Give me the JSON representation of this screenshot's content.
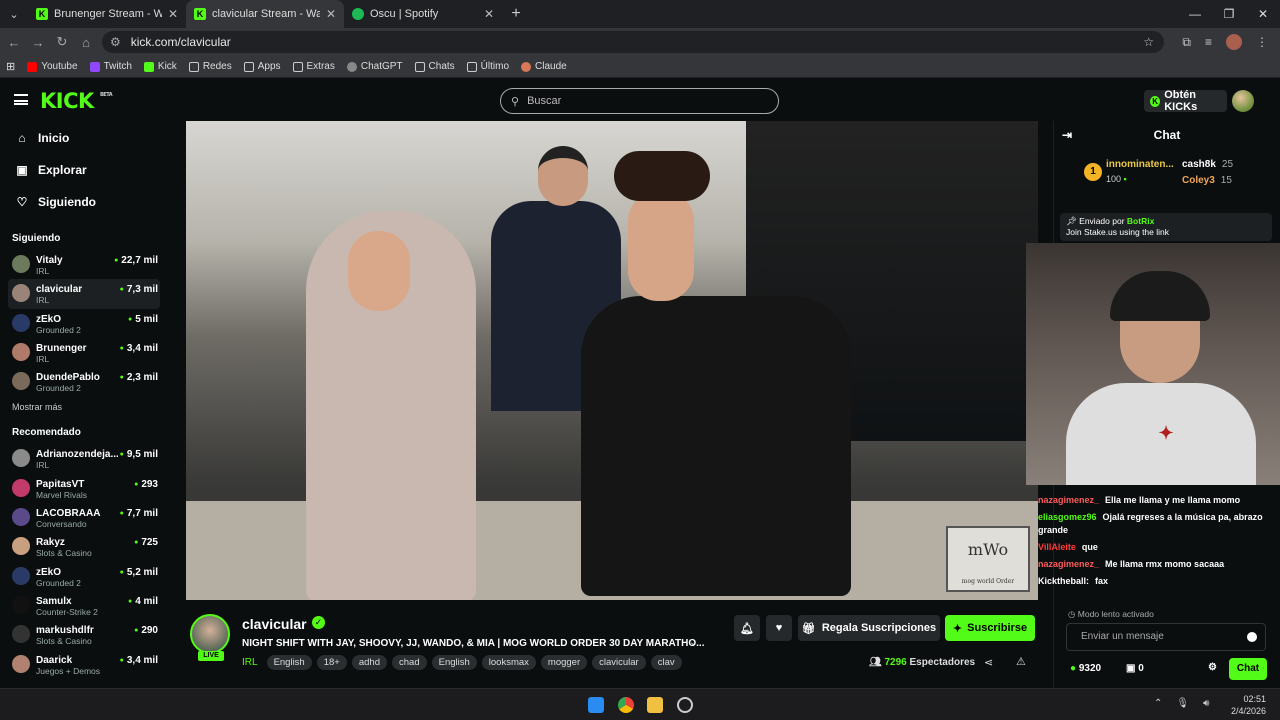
{
  "browser": {
    "tabs": [
      {
        "title": "Brunenger Stream - Watch Live",
        "favicon": "K",
        "color": "#53fc18",
        "active": false
      },
      {
        "title": "clavicular Stream - Watch Live",
        "favicon": "K",
        "color": "#53fc18",
        "active": true
      },
      {
        "title": "Oscu | Spotify",
        "favicon": "S",
        "color": "#1db954",
        "active": false
      }
    ],
    "url": "kick.com/clavicular",
    "bookmarks": [
      "Youtube",
      "Twitch",
      "Kick",
      "Redes",
      "Apps",
      "Extras",
      "ChatGPT",
      "Chats",
      "Último",
      "Claude"
    ]
  },
  "header": {
    "logo": "KICK",
    "logo_tag": "BETA",
    "search_placeholder": "Buscar",
    "get_kicks": "Obtén KICKs"
  },
  "sidebar": {
    "nav": [
      {
        "label": "Inicio",
        "icon": "home-icon"
      },
      {
        "label": "Explorar",
        "icon": "explore-icon"
      },
      {
        "label": "Siguiendo",
        "icon": "heart-icon"
      }
    ],
    "following_title": "Siguiendo",
    "following": [
      {
        "name": "Vitaly",
        "category": "IRL",
        "viewers": "22,7 mil",
        "avatar_color": "#6a7a5a"
      },
      {
        "name": "clavicular",
        "category": "IRL",
        "viewers": "7,3 mil",
        "avatar_color": "#9a8478"
      },
      {
        "name": "zEkO",
        "category": "Grounded 2",
        "viewers": "5 mil",
        "avatar_color": "#2a3a66"
      },
      {
        "name": "Brunenger",
        "category": "IRL",
        "viewers": "3,4 mil",
        "avatar_color": "#b07a6a"
      },
      {
        "name": "DuendePablo",
        "category": "Grounded 2",
        "viewers": "2,3 mil",
        "avatar_color": "#7a6a5a"
      }
    ],
    "show_more": "Mostrar más",
    "recommended_title": "Recomendado",
    "recommended": [
      {
        "name": "Adrianozendeja...",
        "category": "IRL",
        "viewers": "9,5 mil",
        "avatar_color": "#8a8a8a"
      },
      {
        "name": "PapitasVT",
        "category": "Marvel Rivals",
        "viewers": "293",
        "avatar_color": "#c03a6a"
      },
      {
        "name": "LACOBRAAA",
        "category": "Conversando",
        "viewers": "7,7 mil",
        "avatar_color": "#5a4a8a"
      },
      {
        "name": "Rakyz",
        "category": "Slots & Casino",
        "viewers": "725",
        "avatar_color": "#c8a080"
      },
      {
        "name": "zEkO",
        "category": "Grounded 2",
        "viewers": "5,2 mil",
        "avatar_color": "#2a3a66"
      },
      {
        "name": "Samulx",
        "category": "Counter-Strike 2",
        "viewers": "4 mil",
        "avatar_color": "#111111"
      },
      {
        "name": "markushdlfr",
        "category": "Slots & Casino",
        "viewers": "290",
        "avatar_color": "#333333"
      },
      {
        "name": "Daarick",
        "category": "Juegos + Demos",
        "viewers": "3,4 mil",
        "avatar_color": "#b08070"
      }
    ]
  },
  "stream": {
    "channel": "clavicular",
    "live_badge": "LIVE",
    "title": "NIGHT SHIFT WITH JAY, SHOOVY, JJ, WANDO, & MIA | MOG WORLD ORDER 30 DAY MARATHO...",
    "category": "IRL",
    "tags": [
      "English",
      "18+",
      "adhd",
      "chad",
      "English",
      "looksmax",
      "mogger",
      "clavicular",
      "clav"
    ],
    "gift_subs": "Regala Suscripciones",
    "subscribe": "Suscribirse",
    "viewers_count": "7296",
    "viewers_label": "Espectadores",
    "watermark_top": "mWo",
    "watermark_bottom": "mog world Order"
  },
  "chat": {
    "title": "Chat",
    "top_gifter": {
      "rank": "1",
      "name": "innominaten...",
      "value": "100"
    },
    "gifters": [
      {
        "name": "cash8k",
        "value": "25",
        "color": "#ffffff"
      },
      {
        "name": "Coley3",
        "value": "15",
        "color": "#f2a65a"
      }
    ],
    "pinned_by_label": "Enviado por",
    "pinned_by": "BotRix",
    "pinned_text": "Join Stake.us using the link",
    "messages": [
      {
        "user": "nazagimenez_",
        "text": "Ella me llama y me llama momo",
        "color": "#ff5a5a"
      },
      {
        "user": "eliasgomez96",
        "text": "Ojalá regreses a la música pa, abrazo grande",
        "color": "#53fc18"
      },
      {
        "user": "VillAleite",
        "text": "que",
        "color": "#ff3a3a"
      },
      {
        "user": "nazagimenez_",
        "text": "Me llama rmx momo sacaaa",
        "color": "#ff5a5a"
      },
      {
        "user": "Kicktheball:",
        "text": "fax",
        "color": "#ffffff"
      }
    ],
    "slow_mode": "Modo lento activado",
    "input_placeholder": "Enviar un mensaje",
    "kicks_balance": "9320",
    "gifts_count": "0",
    "send_button": "Chat"
  },
  "taskbar": {
    "time": "02:51",
    "date": "2/4/2026"
  }
}
